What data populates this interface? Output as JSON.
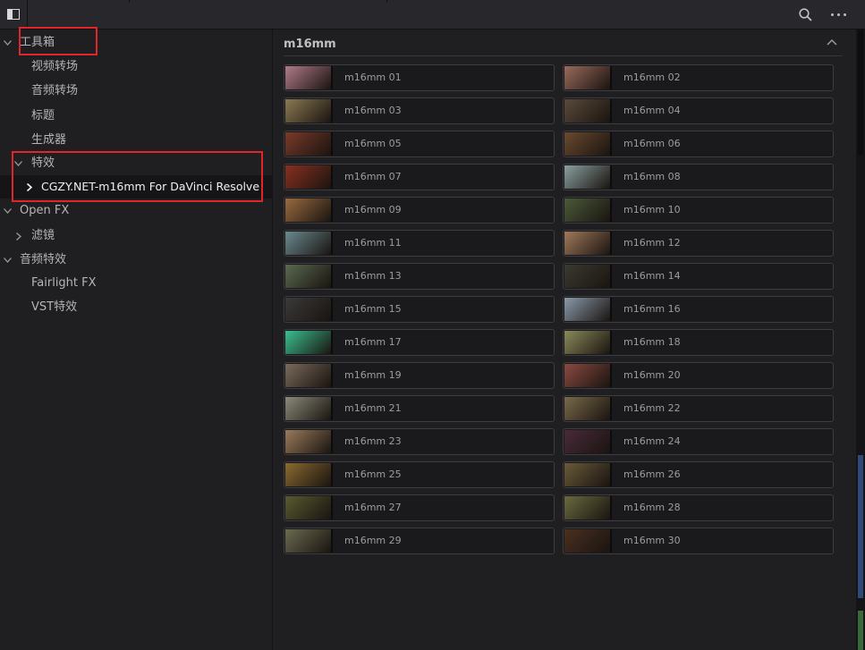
{
  "toolbar": {
    "panel_toggle": "panel-toggle-icon",
    "search": "search-icon",
    "more": "more-options-icon"
  },
  "sidebar": {
    "items": [
      {
        "label": "工具箱",
        "expanded": true
      },
      {
        "label": "视频转场"
      },
      {
        "label": "音频转场"
      },
      {
        "label": "标题"
      },
      {
        "label": "生成器"
      },
      {
        "label": "特效",
        "expanded": true
      },
      {
        "label": "CGZY.NET-m16mm For DaVinci Resolve",
        "selected": true,
        "expanded": false
      },
      {
        "label": "Open FX",
        "expanded": true
      },
      {
        "label": "滤镜",
        "expanded": false
      },
      {
        "label": "音频特效",
        "expanded": true
      },
      {
        "label": "Fairlight FX"
      },
      {
        "label": "VST特效"
      }
    ]
  },
  "main": {
    "section_title": "m16mm",
    "tiles": [
      {
        "label": "m16mm 01",
        "color": "#b07a8a"
      },
      {
        "label": "m16mm 02",
        "color": "#9a6a5c"
      },
      {
        "label": "m16mm 03",
        "color": "#8a7a52"
      },
      {
        "label": "m16mm 04",
        "color": "#5a4a3a"
      },
      {
        "label": "m16mm 05",
        "color": "#7a3a2a"
      },
      {
        "label": "m16mm 06",
        "color": "#6a4a30"
      },
      {
        "label": "m16mm 07",
        "color": "#8a3020"
      },
      {
        "label": "m16mm 08",
        "color": "#8aa0a0"
      },
      {
        "label": "m16mm 09",
        "color": "#9a6a40"
      },
      {
        "label": "m16mm 10",
        "color": "#4a5a3a"
      },
      {
        "label": "m16mm 11",
        "color": "#6a8a90"
      },
      {
        "label": "m16mm 12",
        "color": "#a07a5a"
      },
      {
        "label": "m16mm 13",
        "color": "#5a6a50"
      },
      {
        "label": "m16mm 14",
        "color": "#3a3a30"
      },
      {
        "label": "m16mm 15",
        "color": "#3a3a3a"
      },
      {
        "label": "m16mm 16",
        "color": "#8a9aaa"
      },
      {
        "label": "m16mm 17",
        "color": "#3ac090"
      },
      {
        "label": "m16mm 18",
        "color": "#8a8a5a"
      },
      {
        "label": "m16mm 19",
        "color": "#7a6a5a"
      },
      {
        "label": "m16mm 20",
        "color": "#8a4a40"
      },
      {
        "label": "m16mm 21",
        "color": "#8a8a7a"
      },
      {
        "label": "m16mm 22",
        "color": "#7a6a4a"
      },
      {
        "label": "m16mm 23",
        "color": "#9a7a5a"
      },
      {
        "label": "m16mm 24",
        "color": "#4a2a3a"
      },
      {
        "label": "m16mm 25",
        "color": "#8a6a30"
      },
      {
        "label": "m16mm 26",
        "color": "#6a5a3a"
      },
      {
        "label": "m16mm 27",
        "color": "#5a5a30"
      },
      {
        "label": "m16mm 28",
        "color": "#6a6a40"
      },
      {
        "label": "m16mm 29",
        "color": "#6a6a50"
      },
      {
        "label": "m16mm 30",
        "color": "#4a3020"
      }
    ]
  }
}
